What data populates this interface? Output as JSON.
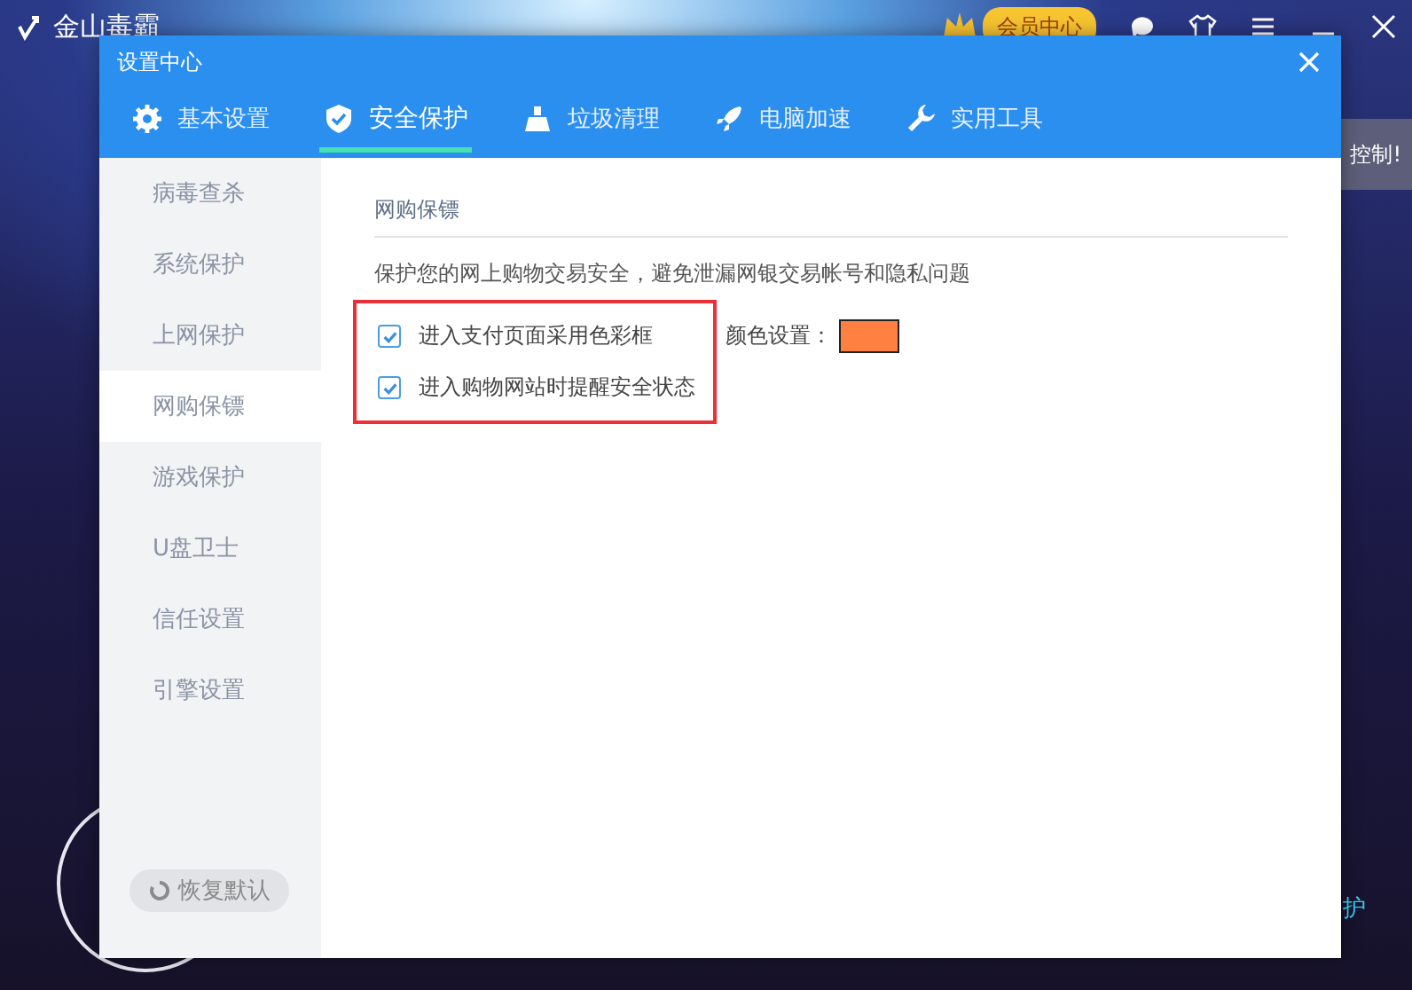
{
  "app": {
    "title": "金山毒霸",
    "vip_label": "会员中心",
    "side_banner": "控制!",
    "bottom_link": "护"
  },
  "dialog": {
    "title": "设置中心",
    "tabs": [
      {
        "label": "基本设置",
        "selected": false
      },
      {
        "label": "安全保护",
        "selected": true
      },
      {
        "label": "垃圾清理",
        "selected": false
      },
      {
        "label": "电脑加速",
        "selected": false
      },
      {
        "label": "实用工具",
        "selected": false
      }
    ],
    "sidebar": {
      "items": [
        {
          "label": "病毒查杀",
          "selected": false
        },
        {
          "label": "系统保护",
          "selected": false
        },
        {
          "label": "上网保护",
          "selected": false
        },
        {
          "label": "网购保镖",
          "selected": true
        },
        {
          "label": "游戏保护",
          "selected": false
        },
        {
          "label": "U盘卫士",
          "selected": false
        },
        {
          "label": "信任设置",
          "selected": false
        },
        {
          "label": "引擎设置",
          "selected": false
        }
      ],
      "reset_button": "恢复默认"
    },
    "section": {
      "title": "网购保镖",
      "description": "保护您的网上购物交易安全，避免泄漏网银交易帐号和隐私问题",
      "highlighted": true,
      "options": [
        {
          "label": "进入支付页面采用色彩框",
          "checked": true,
          "color_setting": {
            "label": "颜色设置：",
            "color": "#ff8040"
          }
        },
        {
          "label": "进入购物网站时提醒安全状态",
          "checked": true
        }
      ]
    }
  }
}
